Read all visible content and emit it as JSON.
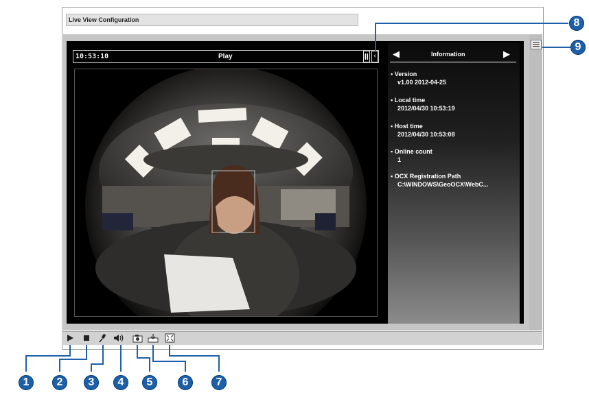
{
  "window": {
    "title": "Live View Configuration"
  },
  "viewer": {
    "time": "10:53:10",
    "status": "Play"
  },
  "info_panel": {
    "title": "Information",
    "items": [
      {
        "label": "Version",
        "value": "v1.00  2012-04-25"
      },
      {
        "label": "Local time",
        "value": "2012/04/30 10:53:19"
      },
      {
        "label": "Host time",
        "value": "2012/04/30 10:53:08"
      },
      {
        "label": "Online count",
        "value": "1"
      },
      {
        "label": "OCX Registration Path",
        "value": "C:\\WINDOWS\\GeoOCX\\WebC..."
      }
    ]
  },
  "toolbar": {
    "buttons": [
      {
        "icon": "play-icon"
      },
      {
        "icon": "stop-icon"
      },
      {
        "icon": "microphone-icon"
      },
      {
        "icon": "speaker-icon"
      },
      {
        "icon": "snapshot-icon"
      },
      {
        "icon": "record-icon"
      },
      {
        "icon": "fullscreen-icon"
      }
    ]
  },
  "callouts": [
    "1",
    "2",
    "3",
    "4",
    "5",
    "6",
    "7",
    "8",
    "9"
  ],
  "colors": {
    "callout": "#1d5fa8",
    "panel_bg": "#000000",
    "toolbar_bg": "#d2d2d2"
  }
}
